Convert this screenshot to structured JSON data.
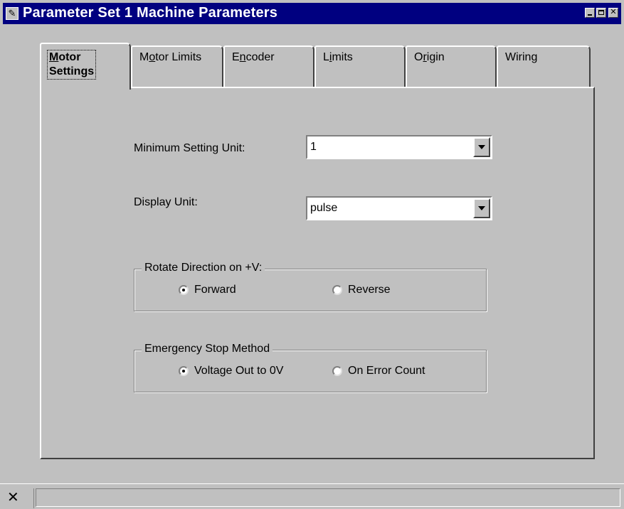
{
  "window": {
    "title": "Parameter Set 1 Machine Parameters"
  },
  "tabs": [
    {
      "line1": "Motor",
      "line2": "Settings",
      "mnemonic": "M",
      "selected": true
    },
    {
      "pre": "M",
      "mn": "o",
      "post": "tor Limits"
    },
    {
      "pre": "E",
      "mn": "n",
      "post": "coder"
    },
    {
      "pre": "L",
      "mn": "i",
      "post": "mits"
    },
    {
      "pre": "O",
      "mn": "r",
      "post": "igin"
    },
    {
      "pre": "Wirin",
      "mn": "g",
      "post": ""
    }
  ],
  "form": {
    "min_setting_unit_label": "Minimum Setting Unit:",
    "min_setting_unit_value": "1",
    "display_unit_label": "Display Unit:",
    "display_unit_value": "pulse"
  },
  "rotate_group": {
    "title": "Rotate Direction on +V:",
    "options": [
      "Forward",
      "Reverse"
    ],
    "selected": "Forward"
  },
  "estop_group": {
    "title": "Emergency Stop Method",
    "options": [
      "Voltage Out to 0V",
      "On Error Count"
    ],
    "selected": "Voltage Out to 0V"
  },
  "status_bar": {
    "icon": "close-icon",
    "text": ""
  },
  "icons": {
    "title_icon": "app-icon",
    "combo_arrow": "chevron-down-icon"
  }
}
